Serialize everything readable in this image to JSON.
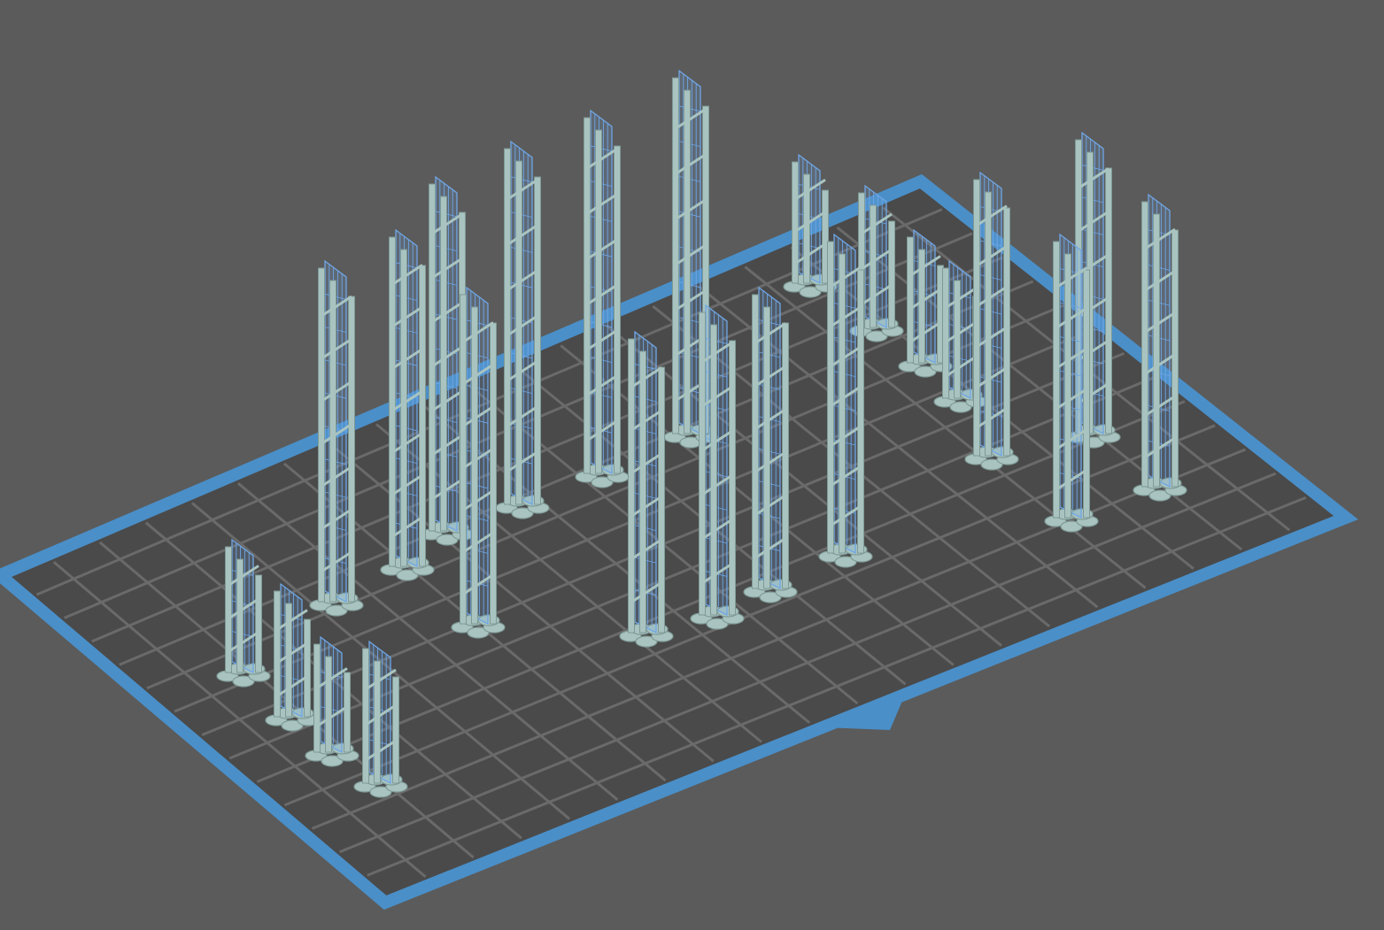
{
  "viewport": {
    "background_color": "#5b5b5b",
    "plate_border_color": "#4a8fc8",
    "plate_fill_color": "#4a4a4a",
    "grid_color": "#6a6a6a",
    "support_color": "#a9c4c0",
    "support_shade_color": "#7f9a96",
    "model_color": "#6fa6e6",
    "front_marker": "front-triangle-icon"
  },
  "models": [
    {
      "id": "m01",
      "height_ratio": 0.45
    },
    {
      "id": "m02",
      "height_ratio": 0.95
    },
    {
      "id": "m03",
      "height_ratio": 0.45
    },
    {
      "id": "m04",
      "height_ratio": 0.45
    },
    {
      "id": "m05",
      "height_ratio": 0.45
    },
    {
      "id": "m06",
      "height_ratio": 1.0
    },
    {
      "id": "m07",
      "height_ratio": 0.95
    },
    {
      "id": "m08",
      "height_ratio": 0.8
    },
    {
      "id": "m09",
      "height_ratio": 0.9
    },
    {
      "id": "m10",
      "height_ratio": 0.95
    },
    {
      "id": "m11",
      "height_ratio": 1.0
    },
    {
      "id": "m12",
      "height_ratio": 0.7
    },
    {
      "id": "m13",
      "height_ratio": 0.8
    },
    {
      "id": "m14",
      "height_ratio": 0.75
    },
    {
      "id": "m15",
      "height_ratio": 0.8
    },
    {
      "id": "m16",
      "height_ratio": 0.4
    },
    {
      "id": "m17",
      "height_ratio": 0.4
    },
    {
      "id": "m18",
      "height_ratio": 0.4
    },
    {
      "id": "m19",
      "height_ratio": 0.35
    },
    {
      "id": "m20",
      "height_ratio": 0.85
    },
    {
      "id": "m21",
      "height_ratio": 0.9
    },
    {
      "id": "m22",
      "height_ratio": 0.85
    },
    {
      "id": "m23",
      "height_ratio": 0.9
    }
  ]
}
